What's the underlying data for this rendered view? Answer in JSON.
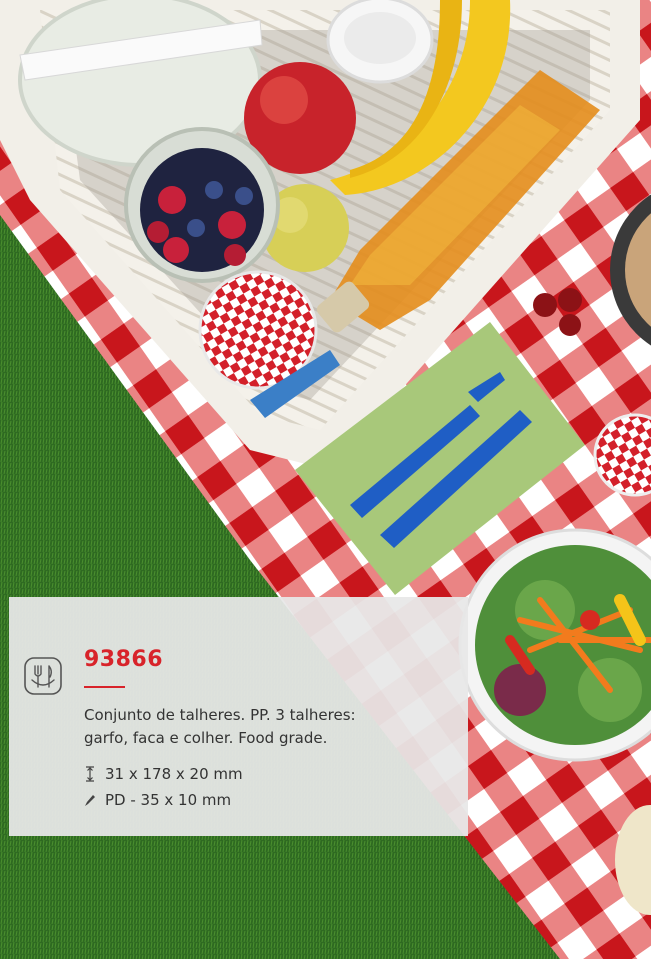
{
  "product": {
    "code": "93866",
    "description": "Conjunto de talheres. PP. 3 talheres: garfo, faca e colher. Food grade.",
    "dimensions": "31 x 178 x 20 mm",
    "print_area": "PD - 35 x 10 mm"
  },
  "icons": [
    "cutlery-icon",
    "dimensions-icon",
    "print-icon"
  ],
  "colors": {
    "accent": "#d8232a",
    "panel": "#e8e8e8",
    "grass": "#2f6b22",
    "gingham_red": "#d42a2a"
  }
}
